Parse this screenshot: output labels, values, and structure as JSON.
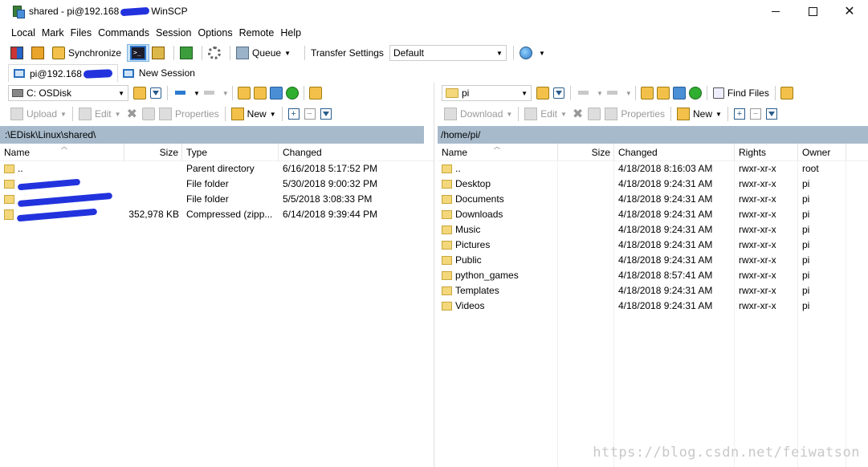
{
  "window": {
    "title_prefix": "shared - pi@192.168",
    "title_suffix": "WinSCP",
    "controls": {
      "minimize": "",
      "maximize": "",
      "close": "✕"
    }
  },
  "menu": [
    "Local",
    "Mark",
    "Files",
    "Commands",
    "Session",
    "Options",
    "Remote",
    "Help"
  ],
  "toolbar": {
    "synchronize": "Synchronize",
    "queue": "Queue",
    "transfer_label": "Transfer Settings",
    "transfer_value": "Default"
  },
  "tabs": {
    "active": "pi@192.168",
    "new_session": "New Session"
  },
  "left": {
    "drive": "C: OSDisk",
    "upload": "Upload",
    "edit": "Edit",
    "properties": "Properties",
    "new": "New",
    "path": ":\\EDisk\\Linux\\shared\\",
    "columns": [
      "Name",
      "Size",
      "Type",
      "Changed"
    ],
    "rows": [
      {
        "name": "..",
        "size": "",
        "type": "Parent directory",
        "changed": "6/16/2018  5:17:52 PM"
      },
      {
        "name": "",
        "size": "",
        "type": "File folder",
        "changed": "5/30/2018  9:00:32 PM"
      },
      {
        "name": "",
        "size": "",
        "type": "File folder",
        "changed": "5/5/2018  3:08:33 PM"
      },
      {
        "name": "",
        "size": "352,978 KB",
        "type": "Compressed (zipp...",
        "changed": "6/14/2018  9:39:44 PM"
      }
    ]
  },
  "right": {
    "drive": "pi",
    "download": "Download",
    "edit": "Edit",
    "properties": "Properties",
    "new": "New",
    "find": "Find Files",
    "path": "/home/pi/",
    "columns": [
      "Name",
      "Size",
      "Changed",
      "Rights",
      "Owner"
    ],
    "rows": [
      {
        "name": "..",
        "changed": "4/18/2018 8:16:03 AM",
        "rights": "rwxr-xr-x",
        "owner": "root"
      },
      {
        "name": "Desktop",
        "changed": "4/18/2018 9:24:31 AM",
        "rights": "rwxr-xr-x",
        "owner": "pi"
      },
      {
        "name": "Documents",
        "changed": "4/18/2018 9:24:31 AM",
        "rights": "rwxr-xr-x",
        "owner": "pi"
      },
      {
        "name": "Downloads",
        "changed": "4/18/2018 9:24:31 AM",
        "rights": "rwxr-xr-x",
        "owner": "pi"
      },
      {
        "name": "Music",
        "changed": "4/18/2018 9:24:31 AM",
        "rights": "rwxr-xr-x",
        "owner": "pi"
      },
      {
        "name": "Pictures",
        "changed": "4/18/2018 9:24:31 AM",
        "rights": "rwxr-xr-x",
        "owner": "pi"
      },
      {
        "name": "Public",
        "changed": "4/18/2018 9:24:31 AM",
        "rights": "rwxr-xr-x",
        "owner": "pi"
      },
      {
        "name": "python_games",
        "changed": "4/18/2018 8:57:41 AM",
        "rights": "rwxr-xr-x",
        "owner": "pi"
      },
      {
        "name": "Templates",
        "changed": "4/18/2018 9:24:31 AM",
        "rights": "rwxr-xr-x",
        "owner": "pi"
      },
      {
        "name": "Videos",
        "changed": "4/18/2018 9:24:31 AM",
        "rights": "rwxr-xr-x",
        "owner": "pi"
      }
    ]
  },
  "watermark": "https://blog.csdn.net/feiwatson"
}
